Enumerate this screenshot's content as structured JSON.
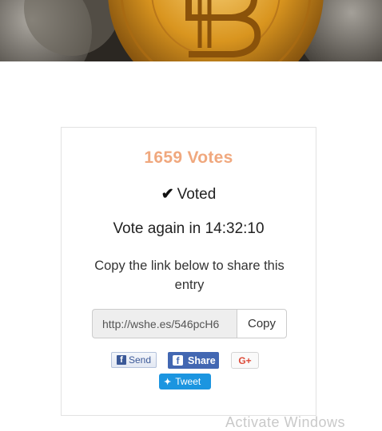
{
  "votes": {
    "count_label": "1659 Votes",
    "status_label": "Voted",
    "countdown_label": "Vote again in 14:32:10"
  },
  "share": {
    "instruction": "Copy the link below to share this entry",
    "link_value": "http://wshe.es/546pcH6",
    "copy_label": "Copy",
    "send_label": "Send",
    "share_label": "Share",
    "gplus_label": "G+",
    "tweet_label": "Tweet"
  },
  "watermark": {
    "text": "Activate Windows"
  },
  "colors": {
    "votes_accent": "#f0a87e",
    "facebook": "#4267b2",
    "twitter": "#1b95e0",
    "gplus": "#dd4b39"
  },
  "icons": {
    "hero": "bitcoin-coin-image",
    "voted": "check-icon",
    "send": "facebook-icon",
    "share": "facebook-icon",
    "tweet": "twitter-bird-icon"
  }
}
